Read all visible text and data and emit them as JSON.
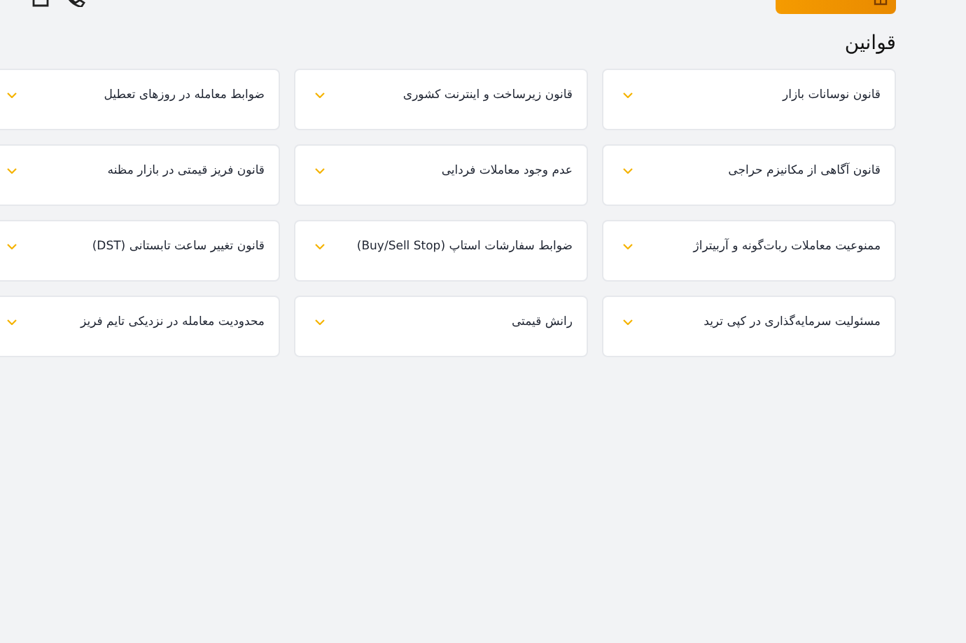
{
  "page_title": "قوانین",
  "rules": [
    {
      "title": "قانون نوسانات بازار",
      "expanded": false
    },
    {
      "title": "قانون زیرساخت و اینترنت کشوری",
      "expanded": false
    },
    {
      "title": "ضوابط معامله در روزهای تعطیل",
      "expanded": false
    },
    {
      "title": "قانون آگاهی از مکانیزم حراجی",
      "expanded": false
    },
    {
      "title": "عدم وجود معاملات فردایی",
      "expanded": false
    },
    {
      "title": "قانون فریز قیمتی در بازار مظنه",
      "expanded": false
    },
    {
      "title": "ممنوعیت معاملات ربات‌گونه و آربیتراژ",
      "expanded": false
    },
    {
      "title": "ضوابط سفارشات استاپ (Buy/Sell Stop)",
      "expanded": false
    },
    {
      "title": "قانون تغییر ساعت تابستانی (DST)",
      "expanded": false
    },
    {
      "title": "مسئولیت سرمایه‌گذاری در کپی ترید",
      "expanded": false
    },
    {
      "title": "رانش قیمتی",
      "expanded": false
    },
    {
      "title": "محدودیت معامله در نزدیکی تایم فریز",
      "expanded": false
    }
  ]
}
